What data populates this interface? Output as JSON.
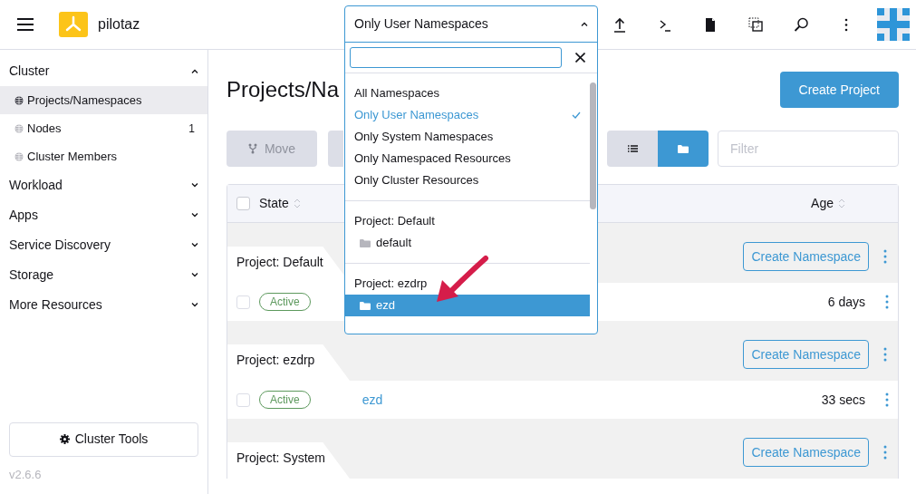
{
  "header": {
    "cluster_name": "pilotaz"
  },
  "sidebar": {
    "groups": [
      {
        "label": "Cluster",
        "expanded": true,
        "items": [
          {
            "label": "Projects/Namespaces",
            "selected": true
          },
          {
            "label": "Nodes",
            "selected": false,
            "count": "1"
          },
          {
            "label": "Cluster Members",
            "selected": false
          }
        ]
      },
      {
        "label": "Workload",
        "expanded": false
      },
      {
        "label": "Apps",
        "expanded": false
      },
      {
        "label": "Service Discovery",
        "expanded": false
      },
      {
        "label": "Storage",
        "expanded": false
      },
      {
        "label": "More Resources",
        "expanded": false
      }
    ],
    "tools_button": "Cluster Tools",
    "version": "v2.6.6"
  },
  "table_header": {
    "select_all_checked": false
  },
  "page": {
    "title": "Projects/Na",
    "create_button": "Create Project",
    "move_button": "Move",
    "view_toggle": [
      {
        "kind": "list",
        "selected": false
      },
      {
        "kind": "folder",
        "selected": true
      }
    ],
    "filter_placeholder": "Filter"
  },
  "table": {
    "columns": [
      "State",
      "Age"
    ],
    "groups": [
      {
        "title": "Project: Default",
        "action": "Create Namespace",
        "rows": [
          {
            "state": "Active",
            "age": "6 days",
            "checked": false
          }
        ]
      },
      {
        "title": "Project: ezdrp",
        "action": "Create Namespace",
        "rows": [
          {
            "state": "Active",
            "name": "ezd",
            "age": "33 secs",
            "checked": false
          }
        ]
      },
      {
        "title": "Project: System",
        "action": "Create Namespace"
      }
    ]
  },
  "namespace_dropdown": {
    "value": "Only User Namespaces",
    "expanded": true,
    "filters": [
      {
        "label": "All Namespaces",
        "selected": false
      },
      {
        "label": "Only User Namespaces",
        "selected": true
      },
      {
        "label": "Only System Namespaces",
        "selected": false
      },
      {
        "label": "Only Namespaced Resources",
        "selected": false
      },
      {
        "label": "Only Cluster Resources",
        "selected": false
      }
    ],
    "projects": [
      {
        "label": "Project: Default",
        "namespaces": [
          {
            "label": "default",
            "highlighted": false
          }
        ]
      },
      {
        "label": "Project: ezdrp",
        "namespaces": [
          {
            "label": "ezd",
            "highlighted": true
          }
        ]
      }
    ]
  }
}
